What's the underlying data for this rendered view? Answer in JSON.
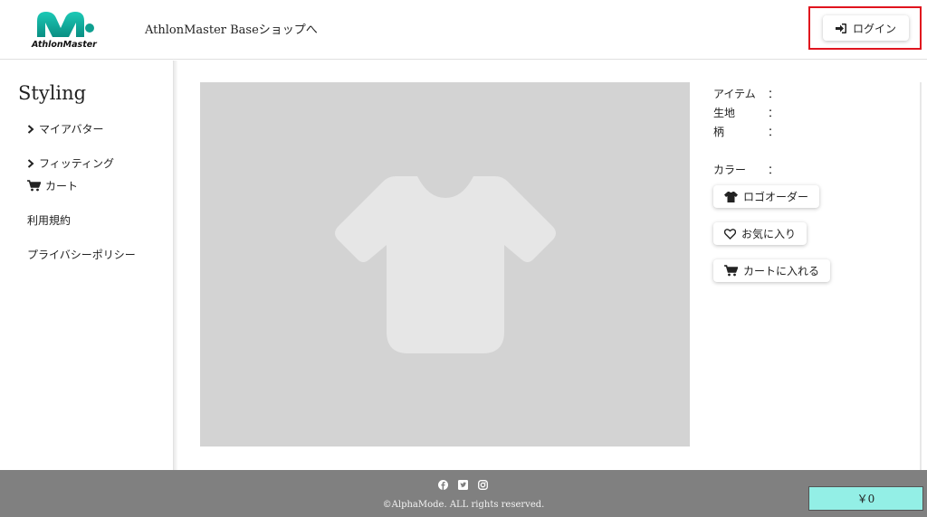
{
  "header": {
    "logo_text": "AthlonMaster",
    "shop_link": "AthlonMaster Baseショップへ",
    "login_label": "ログイン"
  },
  "sidebar": {
    "title": "Styling",
    "items": [
      {
        "label": "マイアバター",
        "icon": "chevron-right-icon"
      },
      {
        "label": "フィッティング",
        "icon": "chevron-right-icon"
      },
      {
        "label": "カート",
        "icon": "cart-icon"
      },
      {
        "label": "利用規約"
      },
      {
        "label": "プライバシーポリシー"
      }
    ]
  },
  "detail": {
    "item_label": "アイテム",
    "fabric_label": "生地",
    "pattern_label": "柄",
    "color_label": "カラー",
    "separator": "：",
    "logo_order_label": "ロゴオーダー",
    "favorite_label": "お気に入り",
    "add_to_cart_label": "カートに入れる"
  },
  "footer": {
    "social": [
      "facebook-icon",
      "twitter-icon",
      "instagram-icon"
    ],
    "copyright": "©AlphaMode. ALL rights reserved.",
    "cart_total": "￥0"
  },
  "colors": {
    "accent": "#11b5a4",
    "highlight": "#e0141e",
    "footer": "#808080",
    "cart_total_bg": "#93efe6"
  }
}
